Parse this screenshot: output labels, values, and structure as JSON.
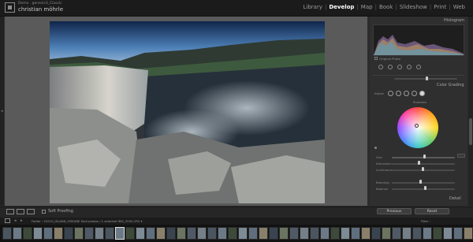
{
  "identity": {
    "line1": "Demo . genesis3_Classic",
    "line2": "christian möhrle"
  },
  "modules": [
    {
      "label": "Library",
      "active": false
    },
    {
      "label": "Develop",
      "active": true
    },
    {
      "label": "Map",
      "active": false
    },
    {
      "label": "Book",
      "active": false
    },
    {
      "label": "Slideshow",
      "active": false
    },
    {
      "label": "Print",
      "active": false
    },
    {
      "label": "Web",
      "active": false
    }
  ],
  "panel": {
    "histogram_label": "Histogram",
    "original_photo_label": "Original Photo",
    "color_grading_label": "Color Grading",
    "wheel_mode_label": "Adjust",
    "shadows_label": "Shadows",
    "sliders": [
      "Hue",
      "Saturation",
      "Luminance"
    ],
    "blending_label": "Blending",
    "balance_label": "Balance",
    "detail_label": "Detail",
    "previous_button": "Previous",
    "reset_button": "Reset"
  },
  "toolbar": {
    "soft_proofing": "Soft Proofing"
  },
  "filmstrip": {
    "info": "Folder : 20210_ISLAND_ORIGINE    Sold photos / 1 selected  IMG_3294.CR2 ▾",
    "filter_label": "Filter :"
  },
  "colors": {
    "accent": "#ffffff",
    "panel_bg": "#2f2f2f",
    "workspace_bg": "#5a5a5a"
  },
  "icons": [
    "grid-icon",
    "loupe-icon",
    "compare-icon",
    "color-wheel-icon",
    "crop-icon",
    "healing-icon",
    "redeye-icon",
    "mask-icon"
  ]
}
